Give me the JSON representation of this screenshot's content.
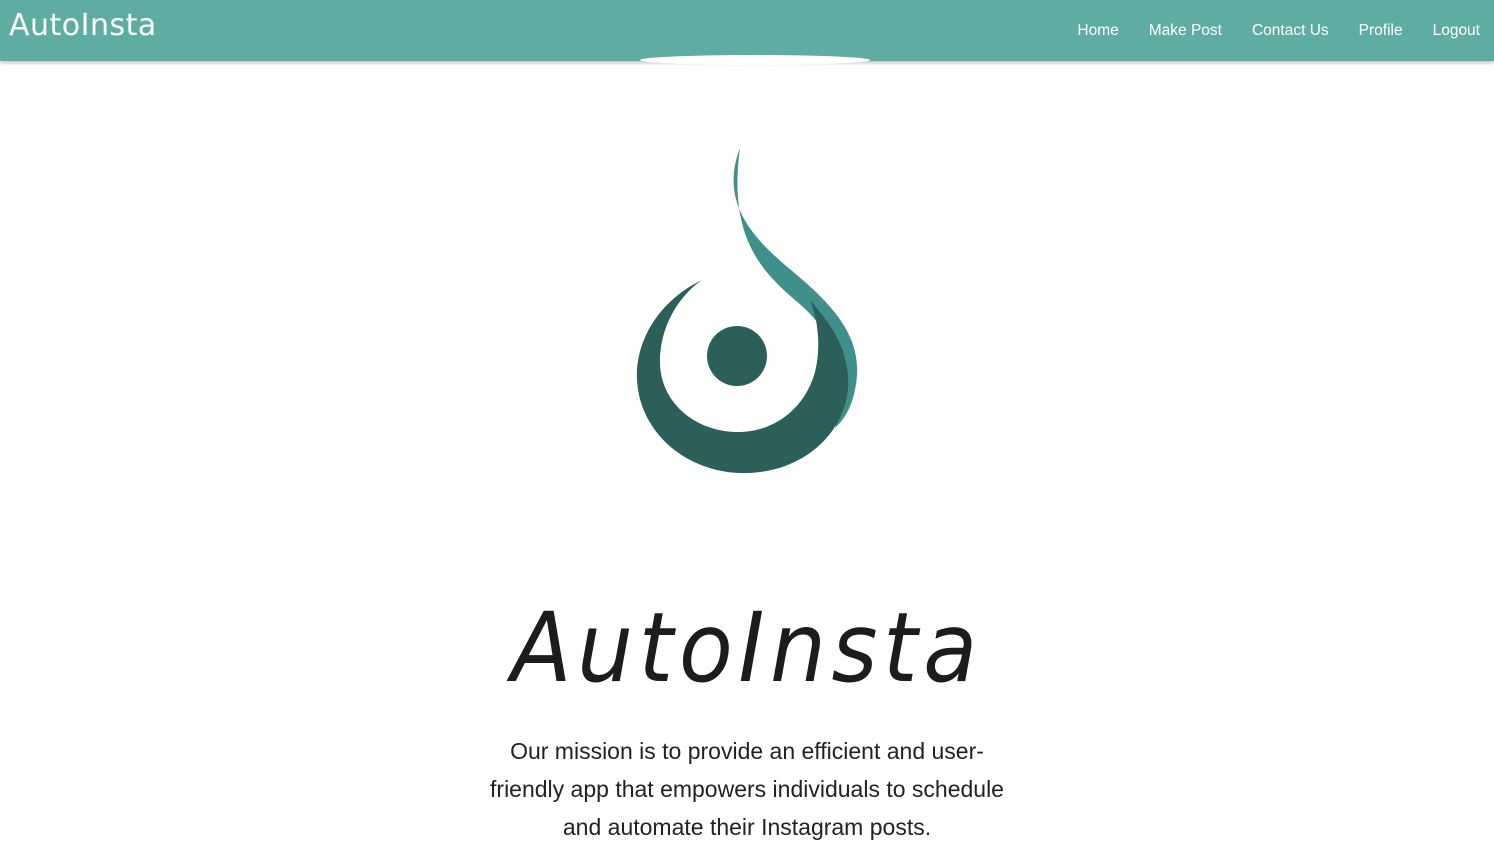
{
  "nav": {
    "brand": "AutoInsta",
    "links": [
      "Home",
      "Make Post",
      "Contact Us",
      "Profile",
      "Logout"
    ]
  },
  "hero": {
    "title": "AutoInsta",
    "mission": "Our mission is to provide an efficient and user-friendly app that empowers individuals to schedule and automate their Instagram posts."
  },
  "logo": {
    "icon": "droplet-swirl-logo",
    "colors": {
      "light": "#3f8f8a",
      "dark": "#2c5f5a"
    }
  },
  "theme": {
    "navbar": "#5fada2",
    "text": "#222222"
  }
}
